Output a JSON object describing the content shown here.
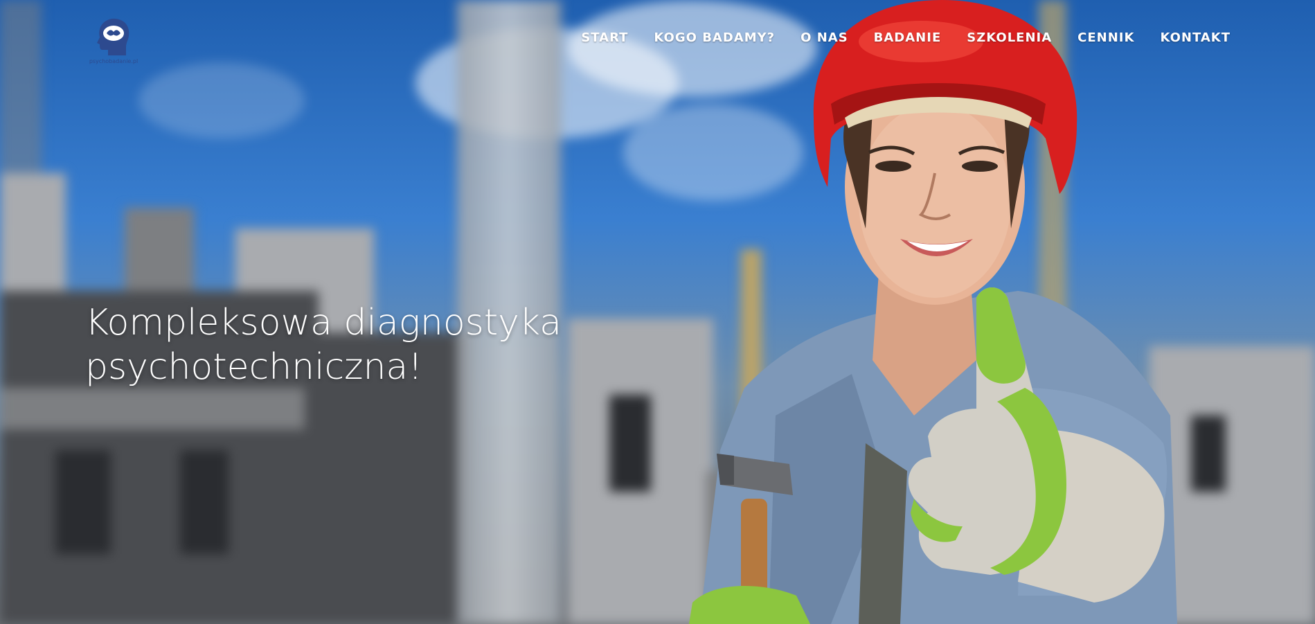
{
  "brand": {
    "logo_text": "psychobadanie.pl",
    "logo_icon": "brain-head-icon"
  },
  "nav": {
    "items": [
      {
        "label": "START"
      },
      {
        "label": "KOGO BADAMY?"
      },
      {
        "label": "O NAS"
      },
      {
        "label": "BADANIE"
      },
      {
        "label": "SZKOLENIA"
      },
      {
        "label": "CENNIK"
      },
      {
        "label": "KONTAKT"
      }
    ]
  },
  "hero": {
    "headline_line1": "Kompleksowa diagnostyka",
    "headline_line2": "psychotechniczna!",
    "background": "construction-site-worker-thumbs-up"
  },
  "colors": {
    "sky": "#2f6fc4",
    "helmet": "#d81f1f",
    "glove": "#8cc63f",
    "logo": "#2d4a8f",
    "nav_text": "#ffffff"
  }
}
